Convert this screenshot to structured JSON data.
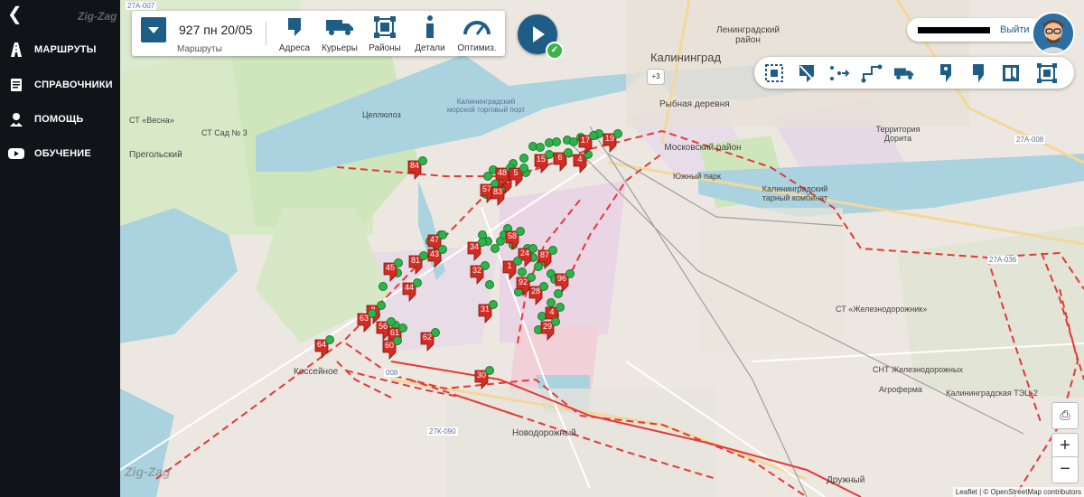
{
  "app": {
    "brand": "Zig-Zag",
    "back_icon": "chevron-left-icon"
  },
  "sidebar": {
    "items": [
      {
        "label": "МАРШРУТЫ",
        "icon": "route-icon"
      },
      {
        "label": "СПРАВОЧНИКИ",
        "icon": "book-icon"
      },
      {
        "label": "ПОМОЩЬ",
        "icon": "help-icon"
      },
      {
        "label": "ОБУЧЕНИЕ",
        "icon": "youtube-icon"
      }
    ]
  },
  "toolbar": {
    "route_value": "927 пн 20/05",
    "route_caption": "Маршруты",
    "tools": [
      {
        "label": "Адреса",
        "icon": "marker-icon"
      },
      {
        "label": "Курьеры",
        "icon": "truck-icon"
      },
      {
        "label": "Районы",
        "icon": "area-icon"
      },
      {
        "label": "Детали",
        "icon": "info-icon"
      },
      {
        "label": "Оптимиз.",
        "icon": "gauge-icon"
      }
    ]
  },
  "user": {
    "logout_label": "Выйти"
  },
  "map": {
    "cluster_badge": "+3",
    "attribution": "Leaflet | © OpenStreetMap contributors",
    "labels": {
      "kaliningrad": "Калининград",
      "leningradsky": "Ленинградский район",
      "rybnaya": "Рыбная деревня",
      "moskovsky": "Московский район",
      "pregolsky": "Прегольский",
      "novodorozhny": "Новодорожный",
      "druzhny": "Дружный",
      "zheleznodorozhnye": "СНТ Железнодорожных",
      "agroferma": "Агроферма",
      "tets": "Калининградская ТЭЦ-2",
      "rail_st": "СТ «Железнодорожник»",
      "vesna": "СТ «Весна»",
      "sad3": "СТ Сад № 3",
      "tsellyuz": "Целлюлоз",
      "yuzhny_park": "Южный парк",
      "tarny": "Калининградский тарный комбинат",
      "dority": "Территория Дорита",
      "kosseinoe": "Коссейное",
      "port": "Калининградский морской торговый порт",
      "r27a036": "27А-036",
      "r27a008": "27А-008",
      "r27k090": "27К-090",
      "r27a007": "27А-007",
      "r008": "008"
    },
    "markers": [
      "84",
      "57",
      "83",
      "52",
      "48",
      "5",
      "15",
      "6",
      "4",
      "17",
      "19",
      "47",
      "81",
      "43",
      "45",
      "44",
      "8",
      "63",
      "64",
      "56",
      "61",
      "60",
      "62",
      "34",
      "32",
      "31",
      "24",
      "87",
      "92",
      "96",
      "28",
      "4",
      "29",
      "30",
      "1",
      "58"
    ]
  },
  "right_tools": [
    "select-area-icon",
    "no-parking-icon",
    "route-points-icon",
    "route-steps-icon",
    "courier-icon",
    "pin-icon",
    "flag-icon",
    "map-layer-icon",
    "fit-bounds-icon"
  ],
  "colors": {
    "accent": "#1e5d86",
    "marker": "#d42b22",
    "marker_dot": "#2db34a",
    "route": "#e53935"
  }
}
